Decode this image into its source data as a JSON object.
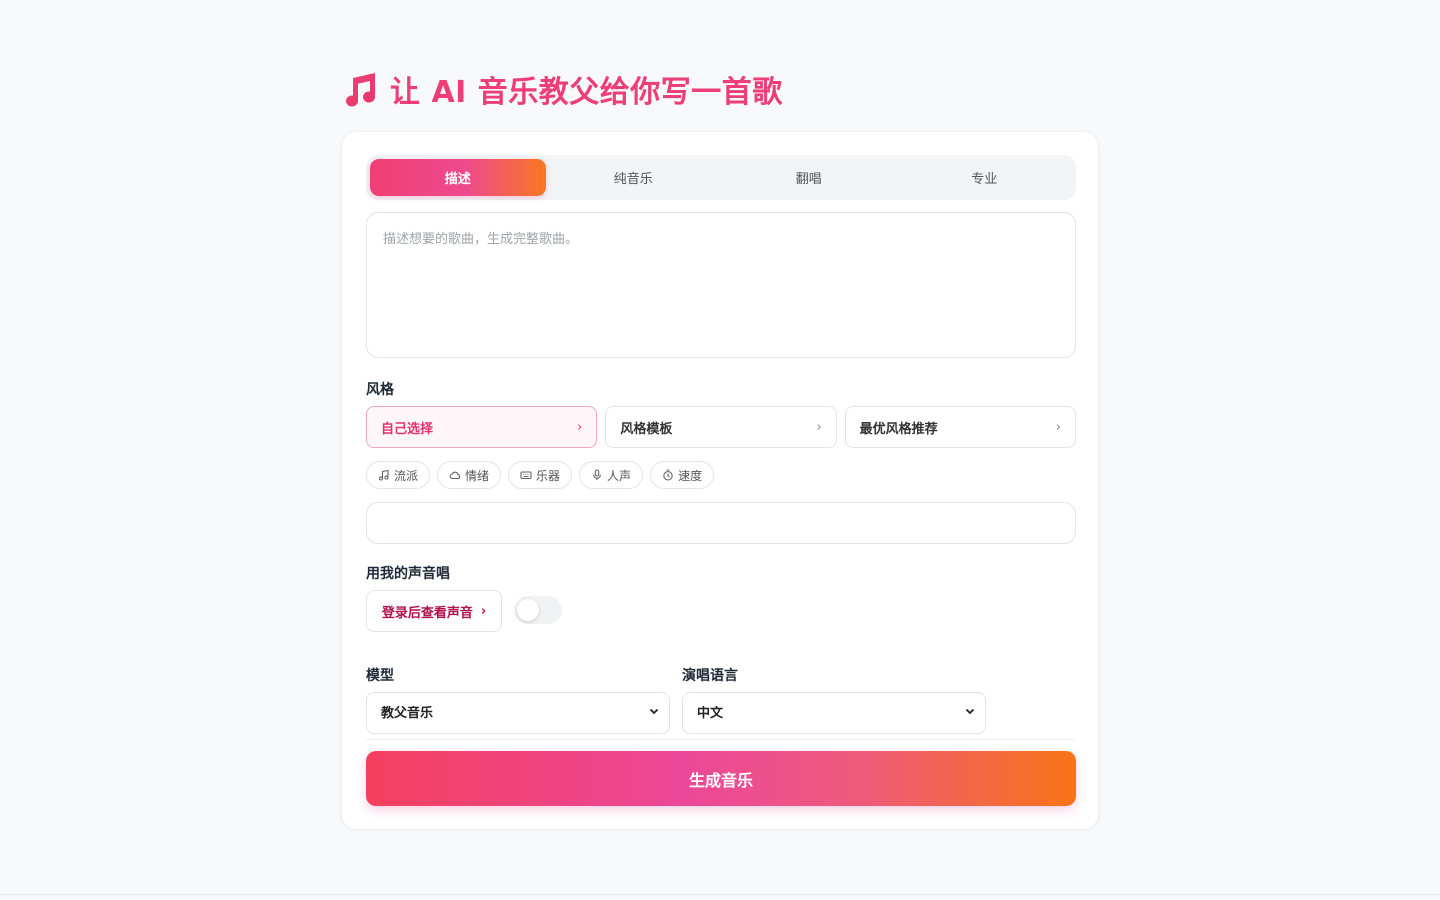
{
  "header": {
    "title": "让 AI 音乐教父给你写一首歌",
    "icon": "music-note-icon",
    "accent_color": "#ec3f78"
  },
  "tabs": [
    {
      "label": "描述",
      "active": true
    },
    {
      "label": "纯音乐",
      "active": false
    },
    {
      "label": "翻唱",
      "active": false
    },
    {
      "label": "专业",
      "active": false
    }
  ],
  "description": {
    "placeholder": "描述想要的歌曲，生成完整歌曲。",
    "value": ""
  },
  "style": {
    "label": "风格",
    "options": [
      {
        "label": "自己选择",
        "active": true
      },
      {
        "label": "风格模板",
        "active": false
      },
      {
        "label": "最优风格推荐",
        "active": false
      }
    ],
    "chips": [
      {
        "label": "流派",
        "icon": "music-note-icon"
      },
      {
        "label": "情绪",
        "icon": "cloud-icon"
      },
      {
        "label": "乐器",
        "icon": "keyboard-icon"
      },
      {
        "label": "人声",
        "icon": "microphone-icon"
      },
      {
        "label": "速度",
        "icon": "timer-icon"
      }
    ],
    "input_value": ""
  },
  "voice": {
    "label": "用我的声音唱",
    "login_button": "登录后查看声音",
    "toggle_on": false
  },
  "model": {
    "label": "模型",
    "selected": "教父音乐"
  },
  "language": {
    "label": "演唱语言",
    "selected": "中文"
  },
  "generate_button": "生成音乐",
  "colors": {
    "gradient_start": "#f43f5e",
    "gradient_mid": "#ec4899",
    "gradient_end": "#f97316"
  }
}
